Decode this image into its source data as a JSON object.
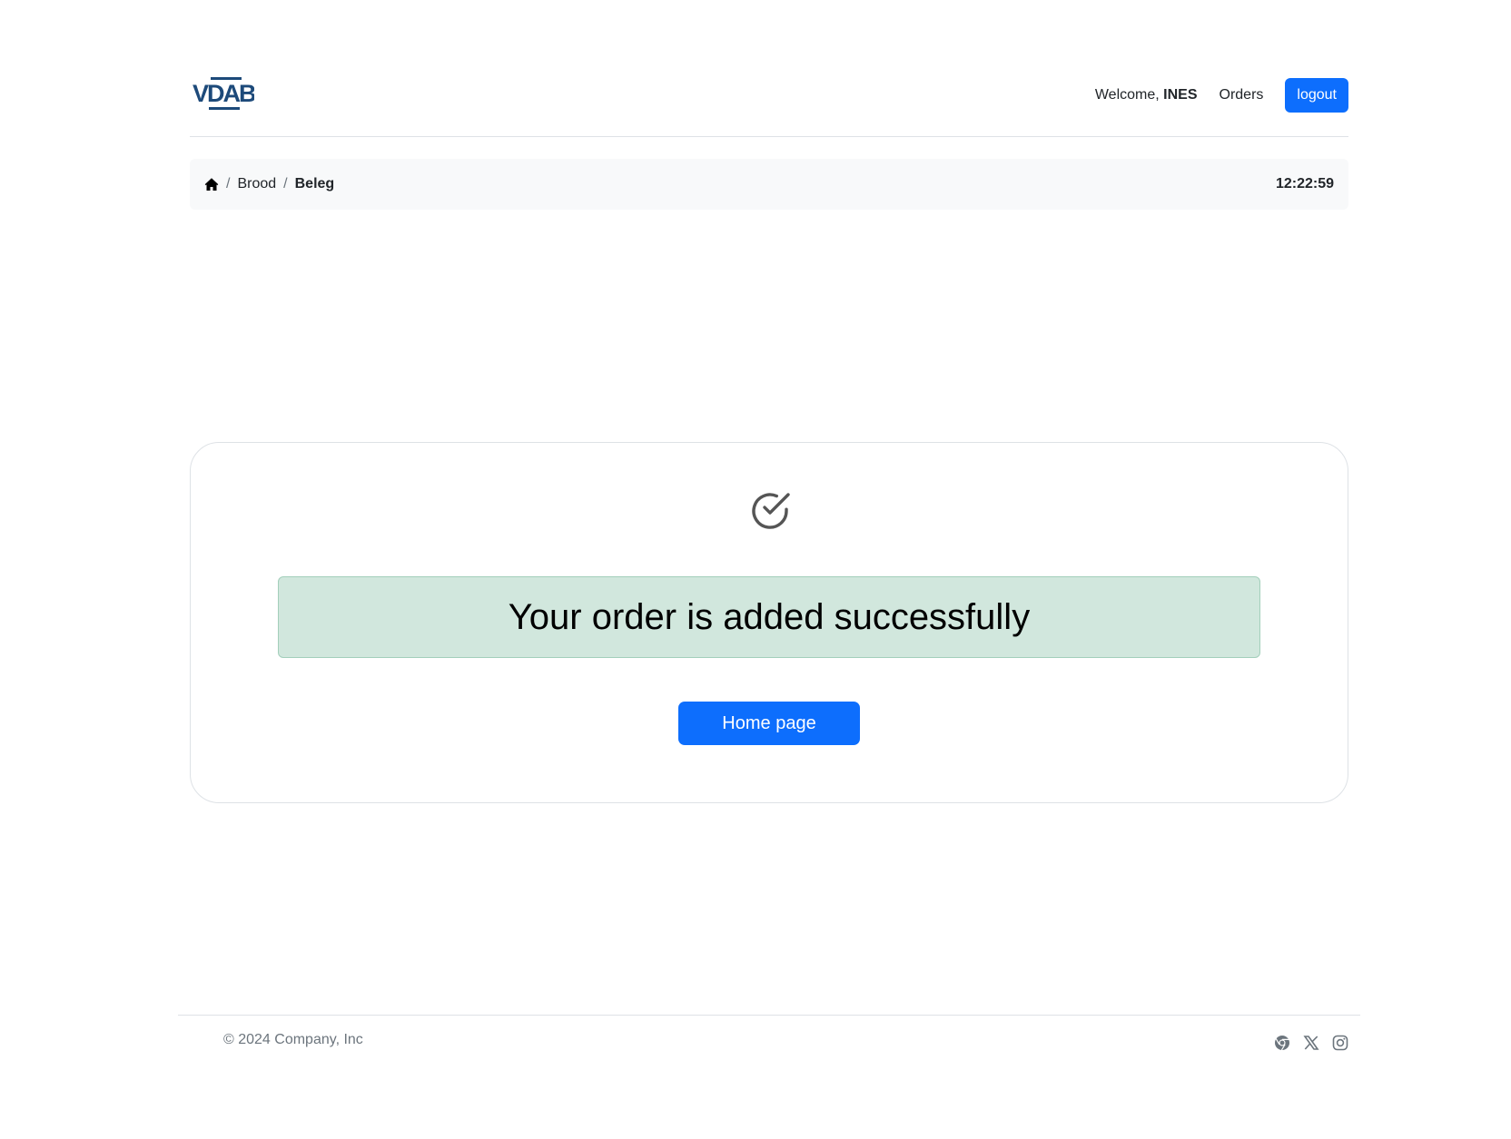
{
  "header": {
    "logo_text": "VDAB",
    "welcome_prefix": "Welcome,",
    "user_name": "INES",
    "orders_label": "Orders",
    "logout_label": "logout"
  },
  "breadcrumb": {
    "items": [
      "Brood",
      "Beleg"
    ],
    "separator": "/",
    "time": "12:22:59"
  },
  "main": {
    "message": "Your order is added successfully",
    "home_button_label": "Home page"
  },
  "footer": {
    "copyright": "© 2024 Company, Inc",
    "social_icons": [
      "chrome-icon",
      "x-icon",
      "instagram-icon"
    ]
  },
  "colors": {
    "primary": "#0d6efd",
    "success_bg": "#d1e7dd",
    "brand": "#1d4a7a"
  }
}
